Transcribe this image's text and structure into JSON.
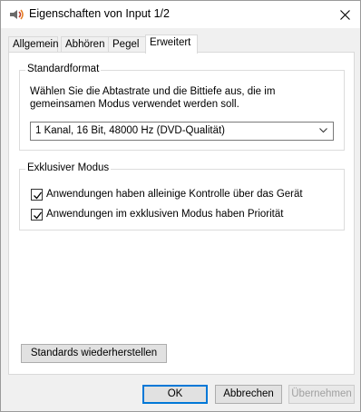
{
  "window": {
    "title": "Eigenschaften von Input 1/2",
    "close_icon": "close-icon",
    "app_icon": "speaker-icon"
  },
  "tabs": [
    {
      "label": "Allgemein",
      "active": false
    },
    {
      "label": "Abhören",
      "active": false
    },
    {
      "label": "Pegel",
      "active": false
    },
    {
      "label": "Erweitert",
      "active": true
    }
  ],
  "standardformat": {
    "title": "Standardformat",
    "description": "Wählen Sie die Abtastrate und die Bittiefe aus, die im gemeinsamen Modus verwendet werden soll.",
    "selected": "1 Kanal, 16 Bit, 48000 Hz (DVD-Qualität)"
  },
  "exclusive": {
    "title": "Exklusiver Modus",
    "options": [
      {
        "label": "Anwendungen haben alleinige Kontrolle über das Gerät",
        "checked": true
      },
      {
        "label": "Anwendungen im exklusiven Modus haben Priorität",
        "checked": true
      }
    ]
  },
  "restore_button": "Standards wiederherstellen",
  "footer": {
    "ok": "OK",
    "cancel": "Abbrechen",
    "apply": "Übernehmen"
  },
  "colors": {
    "accent": "#0078d7",
    "window_bg": "#f0f0f0",
    "panel_bg": "#ffffff"
  }
}
